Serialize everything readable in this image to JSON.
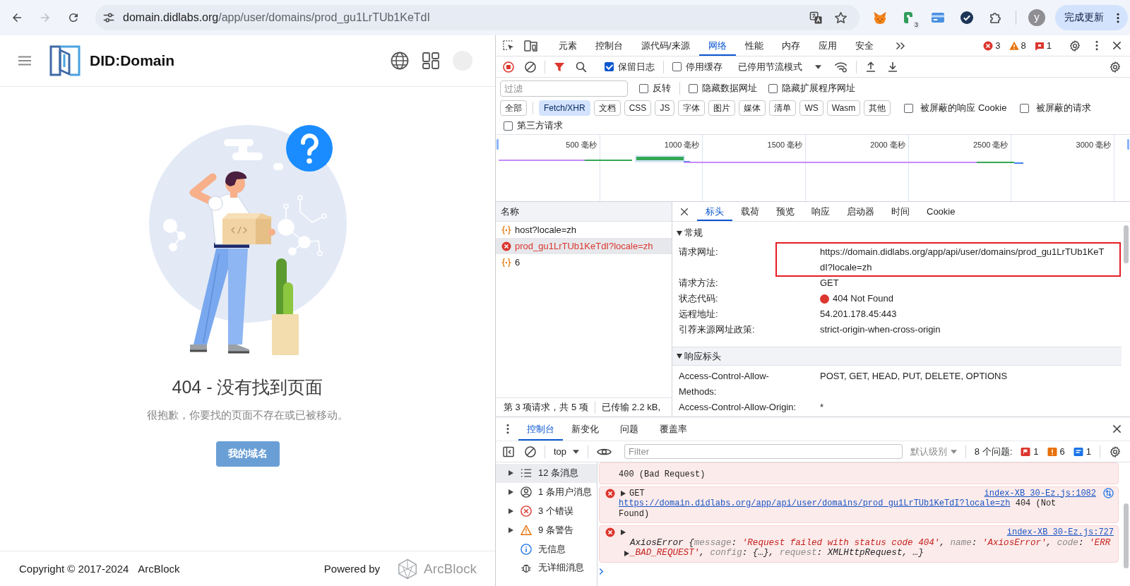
{
  "browser": {
    "back_enabled": true,
    "forward_enabled": false,
    "url_host": "domain.didlabs.org",
    "url_path": "/app/user/domains/prod_gu1LrTUb1KeTdI",
    "extension_badge": "3",
    "profile_initial": "y",
    "update_button": "完成更新"
  },
  "page": {
    "brand": "DID:Domain",
    "error_title": "404 - 没有找到页面",
    "error_message": "很抱歉，你要找的页面不存在或已被移动。",
    "action_button": "我的域名",
    "footer": {
      "copyright": "Copyright © 2017-2024",
      "company": "ArcBlock",
      "powered_by": "Powered by",
      "brand": "ArcBlock"
    }
  },
  "devtools": {
    "tabs": [
      {
        "label": "元素",
        "selected": false
      },
      {
        "label": "控制台",
        "selected": false
      },
      {
        "label": "源代码/来源",
        "selected": false
      },
      {
        "label": "网络",
        "selected": true
      },
      {
        "label": "性能",
        "selected": false
      },
      {
        "label": "内存",
        "selected": false
      },
      {
        "label": "应用",
        "selected": false
      },
      {
        "label": "安全",
        "selected": false
      }
    ],
    "issue_counts": [
      {
        "kind": "error",
        "count": "3"
      },
      {
        "kind": "warning",
        "count": "8"
      },
      {
        "kind": "issue",
        "count": "1"
      }
    ],
    "network": {
      "preserve_log": {
        "label": "保留日志",
        "checked": true
      },
      "disable_cache": {
        "label": "停用缓存",
        "checked": false
      },
      "throttling": "已停用节流模式",
      "filter": {
        "placeholder": "过滤"
      },
      "filter_options": [
        {
          "label": "反转",
          "checked": false
        },
        {
          "label": "隐藏数据网址",
          "checked": false
        },
        {
          "label": "隐藏扩展程序网址",
          "checked": false
        }
      ],
      "type_filters": [
        {
          "label": "全部",
          "selected": false
        },
        {
          "label": "Fetch/XHR",
          "selected": true
        },
        {
          "label": "文档",
          "selected": false
        },
        {
          "label": "CSS",
          "selected": false
        },
        {
          "label": "JS",
          "selected": false
        },
        {
          "label": "字体",
          "selected": false
        },
        {
          "label": "图片",
          "selected": false
        },
        {
          "label": "媒体",
          "selected": false
        },
        {
          "label": "清单",
          "selected": false
        },
        {
          "label": "WS",
          "selected": false
        },
        {
          "label": "Wasm",
          "selected": false
        },
        {
          "label": "其他",
          "selected": false
        }
      ],
      "more_filters": [
        {
          "label": "被屏蔽的响应 Cookie",
          "checked": false
        },
        {
          "label": "被屏蔽的请求",
          "checked": false
        }
      ],
      "third_party": {
        "label": "第三方请求",
        "checked": false
      },
      "timeline_ticks": [
        "500 毫秒",
        "1000 毫秒",
        "1500 毫秒",
        "2000 毫秒",
        "2500 毫秒",
        "3000 毫秒"
      ],
      "requests": {
        "column": "名称",
        "rows": [
          {
            "name": "host?locale=zh",
            "failed": false,
            "selected": false
          },
          {
            "name": "prod_gu1LrTUb1KeTdI?locale=zh",
            "failed": true,
            "selected": true
          },
          {
            "name": "6",
            "failed": false,
            "selected": false
          }
        ]
      },
      "status_bar": [
        "第 3 项请求，共 5 项",
        "已传输 2.2 kB,"
      ],
      "detail": {
        "tabs": [
          {
            "label": "标头",
            "selected": true
          },
          {
            "label": "载荷",
            "selected": false
          },
          {
            "label": "预览",
            "selected": false
          },
          {
            "label": "响应",
            "selected": false
          },
          {
            "label": "启动器",
            "selected": false
          },
          {
            "label": "时间",
            "selected": false
          },
          {
            "label": "Cookie",
            "selected": false
          }
        ],
        "sections": [
          {
            "title": "常规",
            "expanded": true,
            "rows": [
              {
                "name": "请求网址:",
                "value": "https://domain.didlabs.org/app/api/user/domains/prod_gu1LrTUb1KeTdI?locale=zh",
                "highlighted": true
              },
              {
                "name": "请求方法:",
                "value": "GET",
                "highlighted": false
              },
              {
                "name": "状态代码:",
                "value": "404 Not Found",
                "color": "#dc362e",
                "highlighted": false
              },
              {
                "name": "远程地址:",
                "value": "54.201.178.45:443",
                "highlighted": false
              },
              {
                "name": "引荐来源网址政策:",
                "value": "strict-origin-when-cross-origin",
                "highlighted": false
              }
            ]
          },
          {
            "title": "响应标头",
            "expanded": true,
            "rows": [
              {
                "name": "Access-Control-Allow-Methods:",
                "value": "POST, GET, HEAD, PUT, DELETE, OPTIONS",
                "highlighted": false
              },
              {
                "name": "Access-Control-Allow-Origin:",
                "value": "*",
                "highlighted": false
              }
            ]
          }
        ]
      }
    },
    "console": {
      "tabs": [
        {
          "label": "控制台",
          "selected": true
        },
        {
          "label": "新变化",
          "selected": false
        },
        {
          "label": "问题",
          "selected": false
        },
        {
          "label": "覆盖率",
          "selected": false
        }
      ],
      "context": "top",
      "filter_placeholder": "Filter",
      "level_filter": "默认级别",
      "issues_label": "8 个问题:",
      "issue_counts": [
        {
          "kind": "error",
          "count": "1"
        },
        {
          "kind": "warning",
          "count": "6"
        },
        {
          "kind": "info",
          "count": "1"
        }
      ],
      "sidebar": [
        {
          "kind": "messages",
          "label": "12 条消息",
          "selected": true,
          "expandable": true
        },
        {
          "kind": "user",
          "label": "1 条用户消息",
          "selected": false,
          "expandable": true
        },
        {
          "kind": "errors",
          "label": "3 个错误",
          "selected": false,
          "expandable": true
        },
        {
          "kind": "warnings",
          "label": "9 条警告",
          "selected": false,
          "expandable": true
        },
        {
          "kind": "info",
          "label": "无信息",
          "selected": false,
          "expandable": false
        },
        {
          "kind": "verbose",
          "label": "无详细消息",
          "selected": false,
          "expandable": false
        }
      ],
      "messages": [
        {
          "kind": "continuation",
          "error": true,
          "text": "400 (Bad Request)"
        },
        {
          "kind": "request",
          "error": true,
          "expanded": false,
          "method": "GET",
          "source": "index-XB_30-Ez.js:1082",
          "url": "https://domain.didlabs.org/app/api/user/domains/prod_gu1LrTUb1KeTdI?locale=zh",
          "text": "404 (Not Found)"
        },
        {
          "kind": "exception",
          "error": true,
          "expanded": false,
          "object_expanded": false,
          "source": "index-XB_30-Ez.js:727",
          "tokens": [
            {
              "kind": "plain",
              "text": "AxiosError {"
            },
            {
              "kind": "key",
              "text": "message"
            },
            {
              "kind": "plain",
              "text": ": "
            },
            {
              "kind": "string",
              "text": "'Request failed with status code 404'"
            },
            {
              "kind": "plain",
              "text": ", "
            },
            {
              "kind": "key",
              "text": "name"
            },
            {
              "kind": "plain",
              "text": ": "
            },
            {
              "kind": "string",
              "text": "'AxiosError'"
            },
            {
              "kind": "plain",
              "text": ", "
            },
            {
              "kind": "key",
              "text": "code"
            },
            {
              "kind": "plain",
              "text": ": "
            },
            {
              "kind": "string",
              "text": "'ERR_BAD_REQUEST'"
            },
            {
              "kind": "plain",
              "text": ", "
            },
            {
              "kind": "key",
              "text": "config"
            },
            {
              "kind": "plain",
              "text": ": {…}, "
            },
            {
              "kind": "key",
              "text": "request"
            },
            {
              "kind": "plain",
              "text": ": XMLHttpRequest, …}"
            }
          ]
        }
      ]
    }
  }
}
